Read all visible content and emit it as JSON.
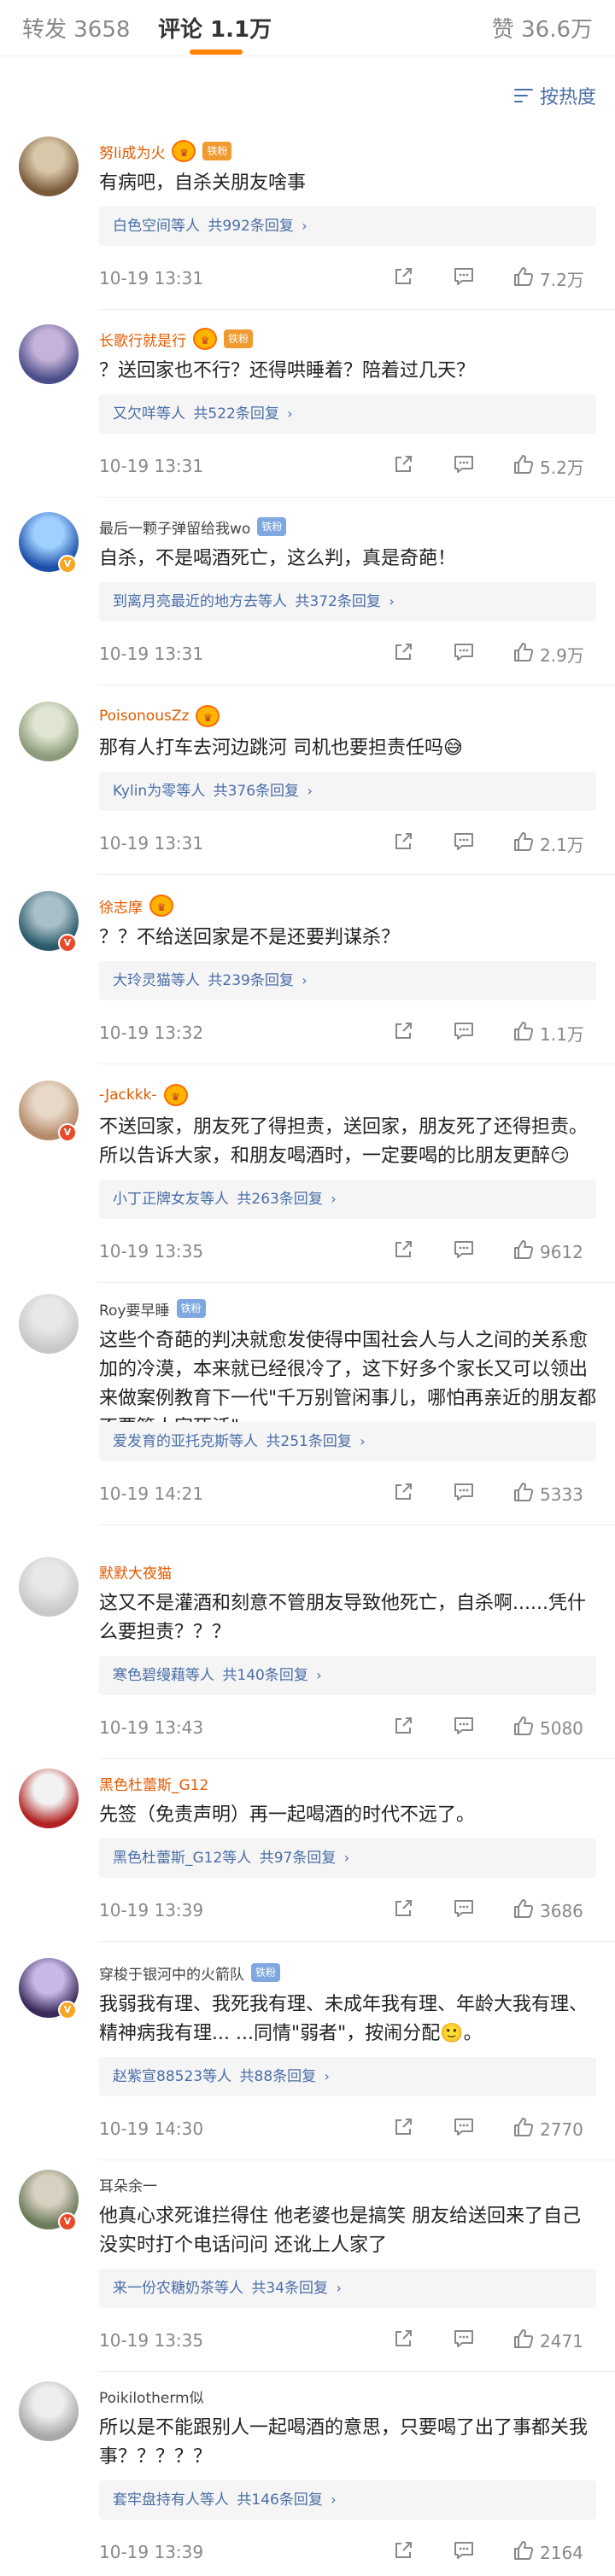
{
  "tabs": {
    "repost": "转发 3658",
    "comment": "评论 1.1万",
    "like": "赞 36.6万"
  },
  "sort": {
    "label": "按热度",
    "icon": "sort-icon"
  },
  "colors": {
    "accent": "#ff8200",
    "link": "#4a6ea8",
    "username": "#e05a00"
  },
  "comments": [
    {
      "username": "努li成为火",
      "badge": "铁粉",
      "text": "有病吧，自杀关朋友啥事",
      "reply": "白色空间等人",
      "reply_count": "共992条回复",
      "time": "10-19 13:31",
      "likes": "7.2万"
    },
    {
      "username": "长歌行就是行",
      "badge": "铁粉",
      "text": "？送回家也不行？还得哄睡着？陪着过几天？",
      "reply": "又欠咩等人",
      "reply_count": "共522条回复",
      "time": "10-19 13:31",
      "likes": "5.2万"
    },
    {
      "username": "最后一颗子弹留给我wo",
      "badge": "铁粉",
      "text": "自杀，不是喝酒死亡，这么判，真是奇葩！",
      "reply": "到离月亮最近的地方去等人",
      "reply_count": "共372条回复",
      "time": "10-19 13:31",
      "likes": "2.9万"
    },
    {
      "username": "PoisonousZz",
      "badge": "",
      "text": "那有人打车去河边跳河 司机也要担责任吗😅",
      "reply": "Kylin为零等人",
      "reply_count": "共376条回复",
      "time": "10-19 13:31",
      "likes": "2.1万"
    },
    {
      "username": "徐志摩",
      "badge": "",
      "text": "？？不给送回家是不是还要判谋杀？",
      "reply": "大玲灵猫等人",
      "reply_count": "共239条回复",
      "time": "10-19 13:32",
      "likes": "1.1万"
    },
    {
      "username": "-Jackkk-",
      "badge": "",
      "text": "不送回家，朋友死了得担责，送回家，朋友死了还得担责。所以告诉大家，和朋友喝酒时，一定要喝的比朋友更醉😏",
      "reply": "小丁正牌女友等人",
      "reply_count": "共263条回复",
      "time": "10-19 13:35",
      "likes": "9612"
    },
    {
      "username": "Roy要早睡",
      "badge": "铁粉",
      "text": "这些个奇葩的判决就愈发使得中国社会人与人之间的关系愈加的冷漠，本来就已经很冷了，这下好多个家长又可以领出来做案例教育下一代\"千万别管闲事儿，哪怕再亲近的朋友都不要管人家死活\"",
      "reply": "爱发育的亚托克斯等人",
      "reply_count": "共251条回复",
      "time": "10-19 14:21",
      "likes": "5333"
    },
    {
      "username": "默默大夜猫",
      "badge": "",
      "text": "这又不是灌酒和刻意不管朋友导致他死亡，自杀啊......凭什么要担责？？？",
      "reply": "寒色碧缦藉等人",
      "reply_count": "共140条回复",
      "time": "10-19 13:43",
      "likes": "5080"
    },
    {
      "username": "黑色杜蕾斯_G12",
      "badge": "",
      "text": "先签（免责声明）再一起喝酒的时代不远了。",
      "reply": "黑色杜蕾斯_G12等人",
      "reply_count": "共97条回复",
      "time": "10-19 13:39",
      "likes": "3686"
    },
    {
      "username": "穿梭于银河中的火箭队",
      "badge": "铁粉",
      "text": "我弱我有理、我死我有理、未成年我有理、年龄大我有理、精神病我有理... ...同情\"弱者\"，按闹分配🙂。",
      "reply": "赵紫宣88523等人",
      "reply_count": "共88条回复",
      "time": "10-19 14:30",
      "likes": "2770"
    },
    {
      "username": "耳朵余一",
      "badge": "",
      "text": "他真心求死谁拦得住 他老婆也是搞笑 朋友给送回来了自己没实时打个电话问问 还讹上人家了",
      "reply": "来一份农糖奶茶等人",
      "reply_count": "共34条回复",
      "time": "10-19 13:35",
      "likes": "2471"
    },
    {
      "username": "Poikilotherm似",
      "badge": "",
      "text": "所以是不能跟别人一起喝酒的意思，只要喝了出了事都关我事？？？？？",
      "reply": "套牢盘持有人等人",
      "reply_count": "共146条回复",
      "time": "10-19 13:39",
      "likes": "2164"
    }
  ]
}
